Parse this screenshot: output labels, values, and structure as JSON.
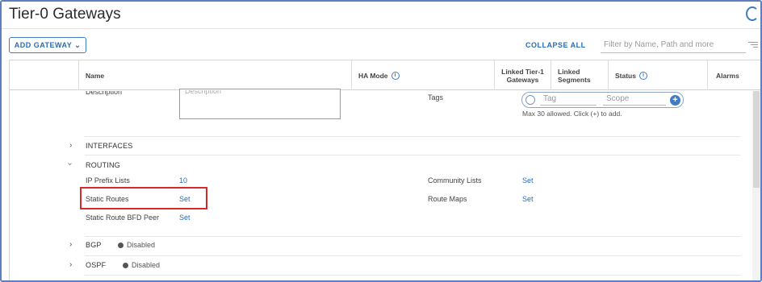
{
  "page": {
    "title": "Tier-0 Gateways"
  },
  "toolbar": {
    "add_gateway_label": "ADD GATEWAY",
    "collapse_all_label": "COLLAPSE ALL",
    "filter_placeholder": "Filter by Name, Path and more"
  },
  "table": {
    "columns": {
      "name": "Name",
      "ha_mode": "HA Mode",
      "linked_tier1_line1": "Linked Tier-1",
      "linked_tier1_line2": "Gateways",
      "linked_segments_line1": "Linked",
      "linked_segments_line2": "Segments",
      "status": "Status",
      "alarms": "Alarms"
    }
  },
  "details": {
    "description_label": "Description",
    "description_placeholder": "Description",
    "tags_label": "Tags",
    "tag_placeholder": "Tag",
    "scope_placeholder": "Scope",
    "tags_hint": "Max 30 allowed. Click (+) to add."
  },
  "sections": {
    "interfaces": "INTERFACES",
    "routing": "ROUTING",
    "bgp": "BGP",
    "bgp_status": "Disabled",
    "ospf": "OSPF",
    "ospf_status": "Disabled"
  },
  "routing": {
    "ip_prefix_lists_label": "IP Prefix Lists",
    "ip_prefix_lists_value": "10",
    "static_routes_label": "Static Routes",
    "static_routes_value": "Set",
    "static_route_bfd_label": "Static Route BFD Peer",
    "static_route_bfd_value": "Set",
    "community_lists_label": "Community Lists",
    "community_lists_value": "Set",
    "route_maps_label": "Route Maps",
    "route_maps_value": "Set"
  },
  "colors": {
    "accent": "#2a6db5",
    "highlight": "#d62b2b",
    "frame": "#5b7fc0"
  }
}
